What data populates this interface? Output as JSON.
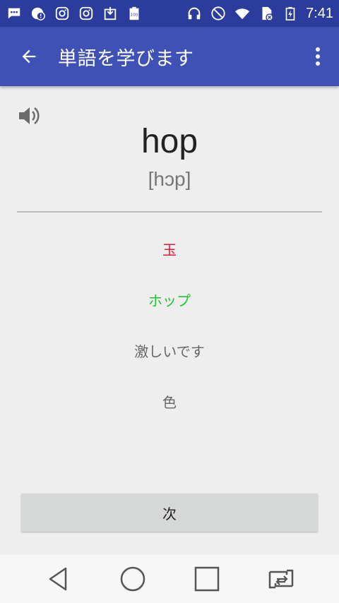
{
  "status_bar": {
    "time": "7:41",
    "icons": [
      "chat-icon",
      "alert-icon",
      "instagram-icon",
      "instagram-icon",
      "download-icon",
      "battery-100-icon",
      "headphones-icon",
      "do-not-disturb-icon",
      "wifi-icon",
      "no-sim-icon",
      "battery-charging-icon"
    ]
  },
  "toolbar": {
    "title": "単語を学びます",
    "back_icon": "arrow-back-icon",
    "menu_icon": "more-vert-icon"
  },
  "card": {
    "speaker_icon": "volume-icon",
    "word": "hop",
    "phonetic": "[hɔp]"
  },
  "options": [
    {
      "label": "玉",
      "color": "#e8173f"
    },
    {
      "label": "ホップ",
      "color": "#1fc42e"
    },
    {
      "label": "激しいです",
      "color": "#666666"
    },
    {
      "label": "色",
      "color": "#666666"
    }
  ],
  "next_button": {
    "label": "次"
  },
  "nav_bar": {
    "icons": [
      "back-triangle-icon",
      "home-circle-icon",
      "recents-square-icon",
      "switch-app-icon"
    ]
  },
  "colors": {
    "status_bar": "#2b3c9c",
    "toolbar": "#3f51b5",
    "background": "#eeeeee"
  }
}
